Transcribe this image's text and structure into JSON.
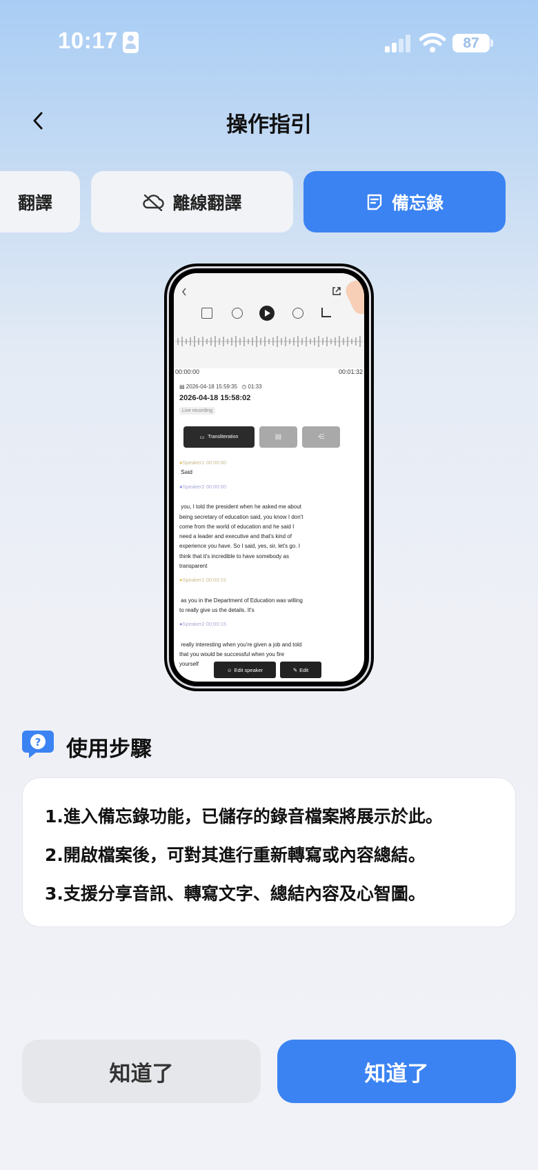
{
  "status": {
    "time": "10:17",
    "battery": "87"
  },
  "header": {
    "title": "操作指引",
    "back_label": "返回"
  },
  "tabs": [
    {
      "label": "翻譯"
    },
    {
      "label": "離線翻譯"
    },
    {
      "label": "備忘錄"
    }
  ],
  "preview": {
    "time_start": "00:00:00",
    "time_end": "00:01:32",
    "meta_datetime": "2026-04-18 15:59:35",
    "meta_duration": "01:33",
    "record_title": "2026-04-18 15:58:02",
    "record_tag": "Live recording",
    "btn_transliteration": "Transliteration",
    "transcript": [
      {
        "speaker": "Speaker1",
        "time": "00:00:00",
        "lines": [
          "Said"
        ]
      },
      {
        "speaker": "Speaker2",
        "time": "00:00:00",
        "lines": [
          " you, I told the president when he asked me about",
          "being secretary of education said, you know I don't",
          "come from the world of education and he said I",
          "need a leader and executive and that's kind of",
          "experience you have. So I said, yes, sir, let's go. I",
          "think that it's incredible to have somebody as",
          "transparent"
        ]
      },
      {
        "speaker": "Speaker1",
        "time": "00:00:15",
        "lines": [
          " as you in the Department of Education was willing",
          "to really give us the details. It's"
        ]
      },
      {
        "speaker": "Speaker2",
        "time": "00:00:15",
        "lines": [
          " really interesting when you're given a job and told",
          "that you would be successful when you fire",
          "yourself"
        ]
      }
    ],
    "edit_speaker_label": "Edit speaker",
    "edit_label": "Edit"
  },
  "steps": {
    "title": "使用步驟",
    "items": [
      "1.進入備忘錄功能，已儲存的錄音檔案將展示於此。",
      "2.開啟檔案後，可對其進行重新轉寫或內容總結。",
      "3.支援分享音訊、轉寫文字、總結內容及心智圖。"
    ]
  },
  "buttons": {
    "secondary": "知道了",
    "primary": "知道了"
  },
  "colors": {
    "accent": "#3b83f2",
    "tab_bg": "#f1f3f6",
    "secondary_btn": "#e6e7ea"
  }
}
